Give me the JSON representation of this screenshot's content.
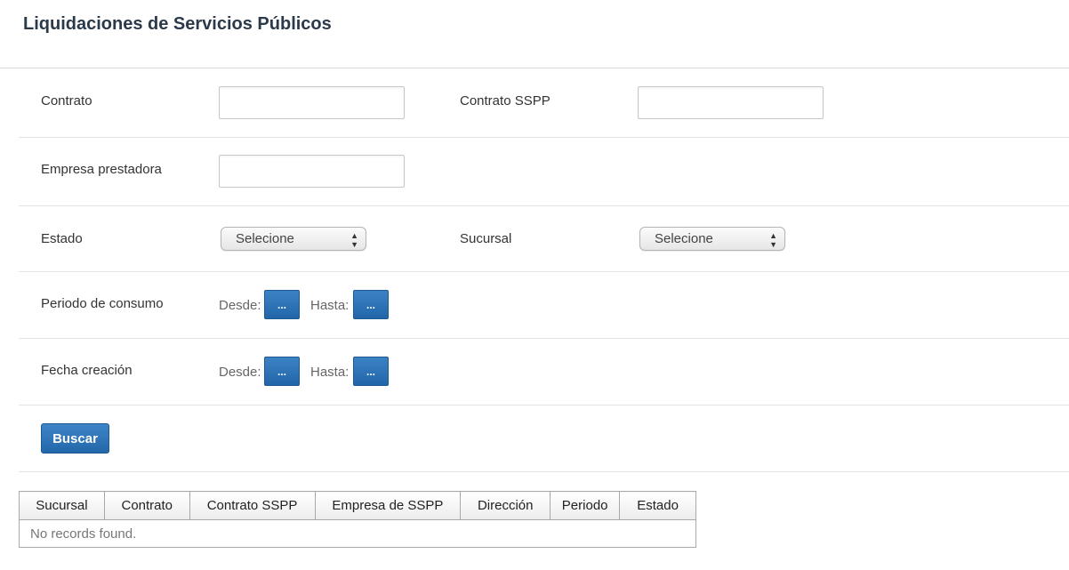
{
  "page": {
    "title": "Liquidaciones de Servicios Públicos"
  },
  "filters": {
    "contrato_label": "Contrato",
    "contrato_value": "",
    "contrato_sspp_label": "Contrato SSPP",
    "contrato_sspp_value": "",
    "empresa_label": "Empresa prestadora",
    "empresa_value": "",
    "estado_label": "Estado",
    "estado_selected": "Selecione",
    "sucursal_label": "Sucursal",
    "sucursal_selected": "Selecione",
    "periodo_label": "Periodo de consumo",
    "fecha_label": "Fecha creación",
    "desde_label": "Desde:",
    "hasta_label": "Hasta:",
    "date_button_label": "...",
    "search_button_label": "Buscar"
  },
  "table": {
    "columns": [
      "Sucursal",
      "Contrato",
      "Contrato SSPP",
      "Empresa de SSPP",
      "Dirección",
      "Periodo",
      "Estado"
    ],
    "empty_message": "No records found."
  },
  "icons": {
    "select_arrows": "updown-arrows-icon"
  }
}
